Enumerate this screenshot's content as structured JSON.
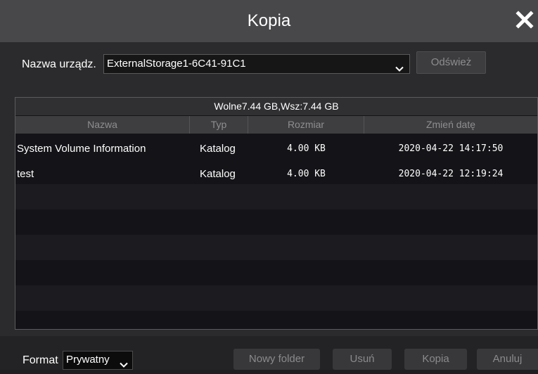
{
  "window": {
    "title": "Kopia"
  },
  "device": {
    "label": "Nazwa urządz.",
    "selected": "ExternalStorage1-6C41-91C1",
    "refresh_label": "Odśwież"
  },
  "storage": {
    "info": "Wolne7.44 GB,Wsz:7.44 GB"
  },
  "table": {
    "columns": [
      "Nazwa",
      "Typ",
      "Rozmiar",
      "Zmień datę"
    ],
    "rows": [
      {
        "name": "System Volume Information",
        "type": "Katalog",
        "size": "4.00 KB",
        "date": "2020-04-22 14:17:50"
      },
      {
        "name": "test",
        "type": "Katalog",
        "size": "4.00 KB",
        "date": "2020-04-22 12:19:24"
      }
    ]
  },
  "footer": {
    "format_label": "Format",
    "format_value": "Prywatny",
    "buttons": {
      "new_folder": "Nowy folder",
      "delete": "Usuń",
      "copy": "Kopia",
      "cancel": "Anuluj"
    }
  },
  "icons": [
    "close-icon",
    "chevron-down-icon"
  ]
}
